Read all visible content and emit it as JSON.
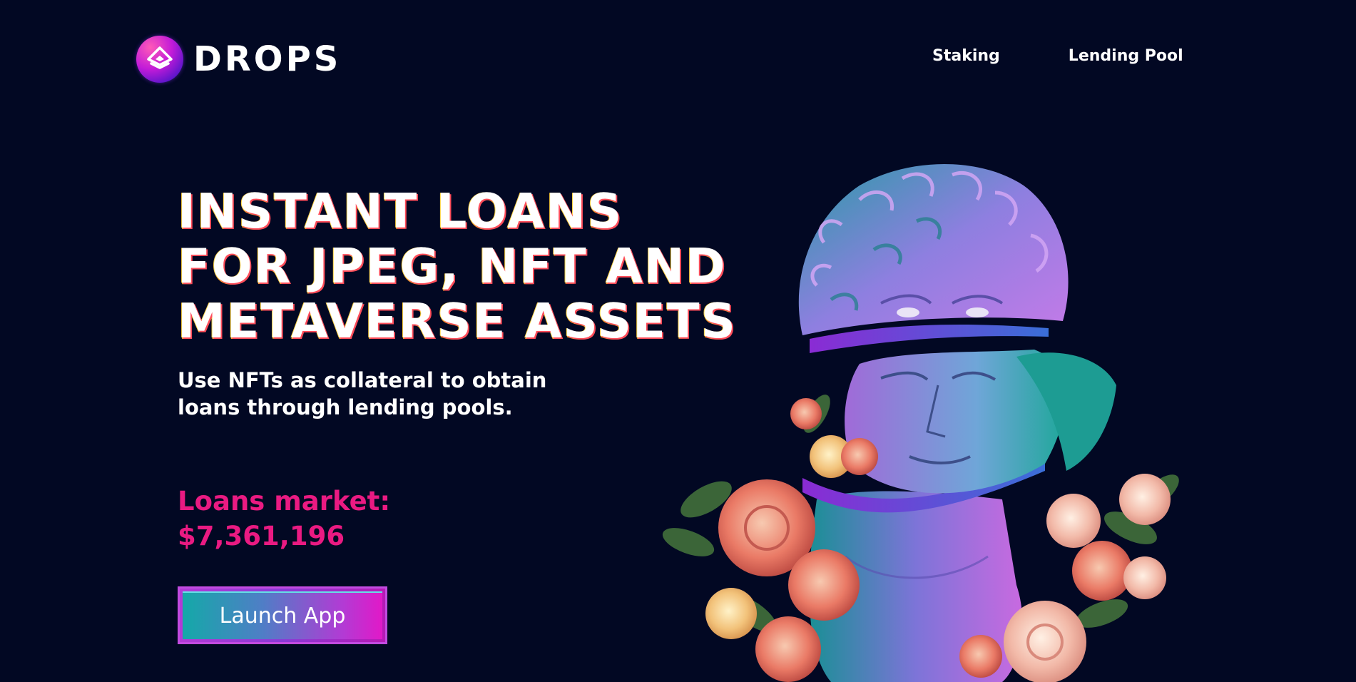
{
  "header": {
    "logo_text": "DROPS",
    "logo_icon": "drops-logo-icon",
    "nav": [
      {
        "label": "Staking"
      },
      {
        "label": "Lending Pool"
      }
    ]
  },
  "hero": {
    "title_lines": [
      "INSTANT LOANS",
      "FOR JPEG, NFT AND",
      "METAVERSE ASSETS"
    ],
    "subtitle": "Use NFTs as collateral to obtain loans through lending pools.",
    "market_label": "Loans market:",
    "market_value": "$7,361,196",
    "cta_label": "Launch App"
  },
  "colors": {
    "background": "#020823",
    "accent_pink": "#ea1a82",
    "button_teal": "#14a9a8",
    "button_magenta": "#e119c8"
  }
}
